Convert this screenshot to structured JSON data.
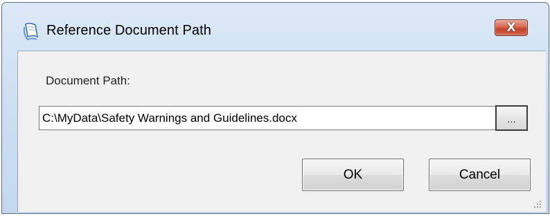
{
  "window": {
    "title": "Reference Document Path",
    "close_label": "X"
  },
  "form": {
    "path_label": "Document Path:",
    "path_value": "C:\\MyData\\Safety Warnings and Guidelines.docx",
    "browse_label": "..."
  },
  "buttons": {
    "ok_label": "OK",
    "cancel_label": "Cancel"
  },
  "icons": {
    "title": "document-app-icon",
    "close": "close-icon",
    "grip": "resize-grip-icon"
  },
  "colors": {
    "title_bar": "#cddff2",
    "close_button": "#c4432b",
    "client_area": "#f0f0f0"
  }
}
